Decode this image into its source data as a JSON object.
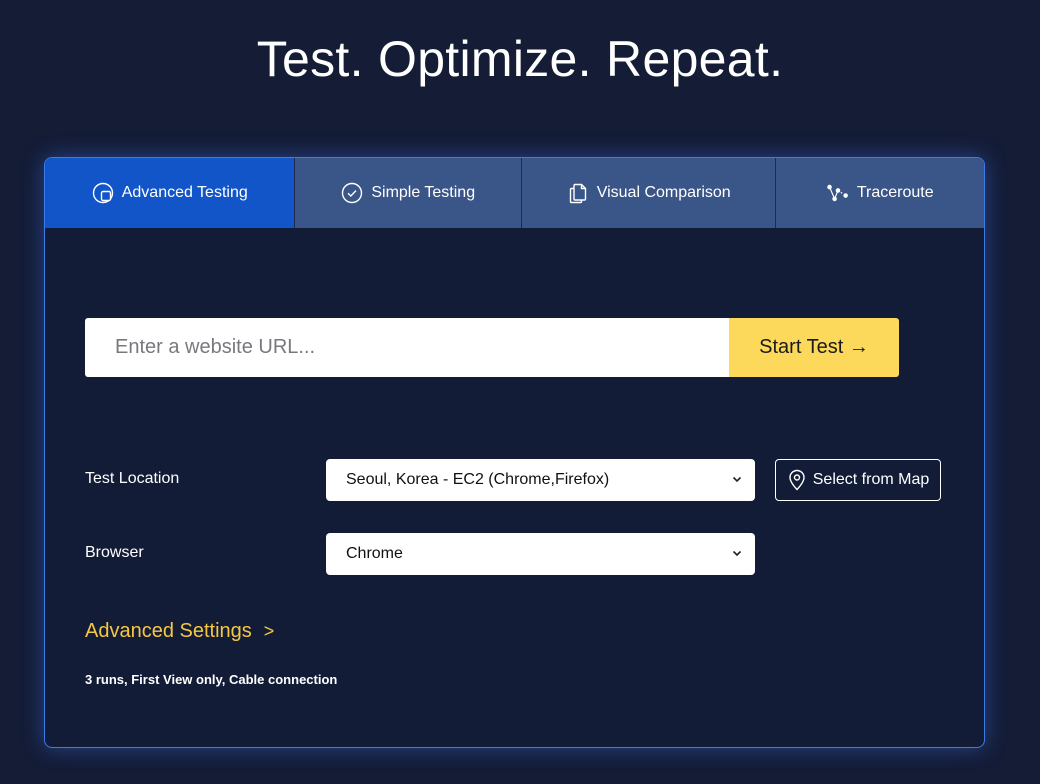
{
  "headline": "Test. Optimize. Repeat.",
  "tabs": [
    {
      "label": "Advanced Testing",
      "icon": "advanced-testing-icon",
      "active": true
    },
    {
      "label": "Simple Testing",
      "icon": "check-circle-icon",
      "active": false
    },
    {
      "label": "Visual Comparison",
      "icon": "documents-icon",
      "active": false
    },
    {
      "label": "Traceroute",
      "icon": "route-nodes-icon",
      "active": false
    }
  ],
  "url_input": {
    "placeholder": "Enter a website URL...",
    "value": ""
  },
  "start_button": {
    "label": "Start Test →"
  },
  "test_location": {
    "label": "Test Location",
    "selected": "Seoul, Korea - EC2 (Chrome,Firefox)"
  },
  "map_button": {
    "label": "Select from Map",
    "icon": "map-pin-icon"
  },
  "browser": {
    "label": "Browser",
    "selected": "Chrome"
  },
  "advanced_settings": {
    "label": "Advanced Settings",
    "arrow": ">"
  },
  "summary": "3 runs, First View only, Cable connection",
  "colors": {
    "background": "#141c36",
    "tab_active": "#1155c8",
    "tab_inactive": "#3a5688",
    "start_button": "#fcd95a",
    "accent_link": "#f5c842",
    "card_border": "#3d7be6"
  }
}
